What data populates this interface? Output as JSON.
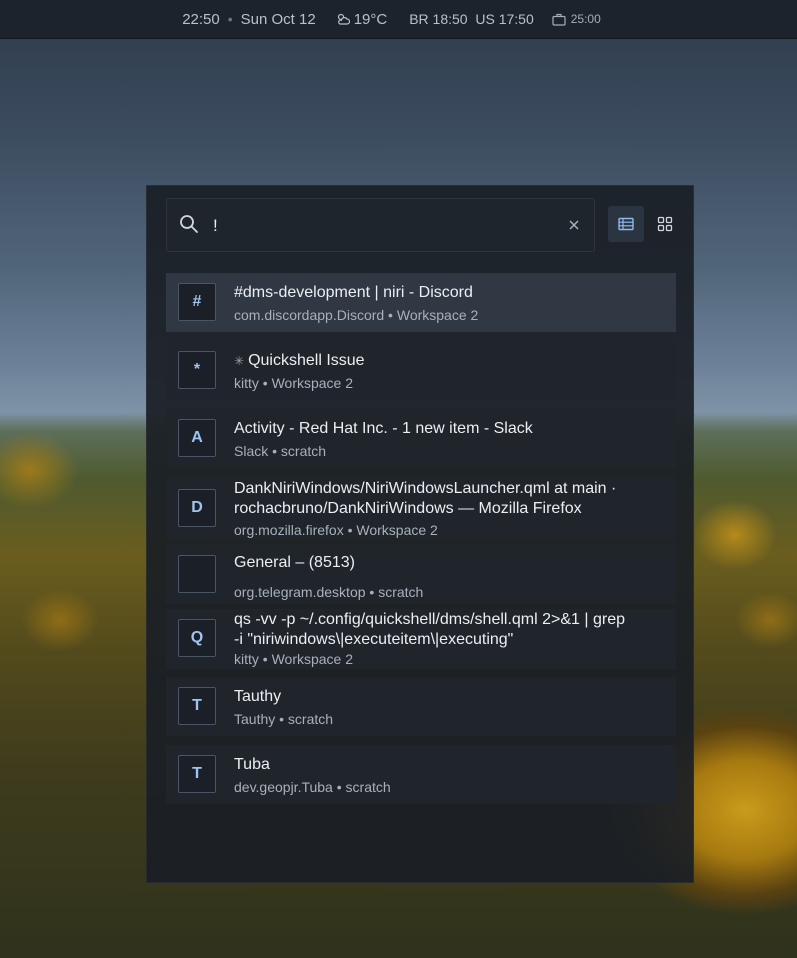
{
  "topbar": {
    "time": "22:50",
    "separator": "•",
    "date": "Sun Oct 12",
    "weather_icon": "weather-icon",
    "temperature": "19°C",
    "timezones": "BR 18:50  US 17:50",
    "timer_icon": "briefcase-icon",
    "timer": "25:00"
  },
  "launcher": {
    "search": {
      "value": "!",
      "placeholder": ""
    },
    "view_modes": [
      "list",
      "grid"
    ],
    "active_view": "list",
    "results": [
      {
        "icon_letter": "#",
        "title": "#dms-development | niri - Discord",
        "subtitle": "com.discordapp.Discord • Workspace 2",
        "selected": true
      },
      {
        "icon_letter": "*",
        "prefix": "✳",
        "title": "Quickshell Issue",
        "subtitle": "kitty • Workspace 2"
      },
      {
        "icon_letter": "A",
        "title": "Activity - Red Hat Inc. - 1 new item - Slack",
        "subtitle": "Slack • scratch"
      },
      {
        "icon_letter": "D",
        "title": "DankNiriWindows/NiriWindowsLauncher.qml at main · rochacbruno/DankNiriWindows — Mozilla Firefox",
        "subtitle": "org.mozilla.firefox • Workspace 2"
      },
      {
        "icon_letter": "",
        "title": "General – (8513)",
        "subtitle": "org.telegram.desktop • scratch"
      },
      {
        "icon_letter": "Q",
        "title": "qs -vv -p ~/.config/quickshell/dms/shell.qml 2>&1 | grep -i \"niriwindows\\|executeitem\\|executing\"",
        "subtitle": "kitty • Workspace 2"
      },
      {
        "icon_letter": "T",
        "title": "Tauthy",
        "subtitle": "Tauthy • scratch"
      },
      {
        "icon_letter": "T",
        "title": "Tuba",
        "subtitle": "dev.geopjr.Tuba • scratch"
      }
    ]
  },
  "colors": {
    "accent": "#9fc4f0",
    "panel": "#1a1e25",
    "selected": "#2f3843"
  }
}
